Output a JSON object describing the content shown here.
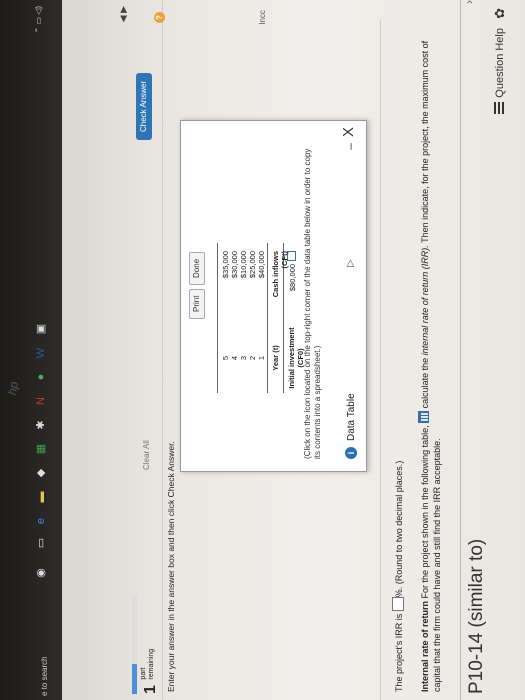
{
  "header": {
    "title": "P10-14 (similar to)",
    "question_help": "Question Help"
  },
  "problem": {
    "lead": "Internal rate of return",
    "text_a": " For the project shown in the following table,",
    "text_b": " calculate the ",
    "irr_term": "internal rate of return (IRR).",
    "text_c": " Then indicate, for the project, the maximum cost of capital that the firm could have and still find the IRR acceptable.",
    "irr_prefix": "The project's IRR is ",
    "irr_value": "",
    "irr_suffix": "%. (Round to two decimal places.)"
  },
  "popup": {
    "title": "Data Table",
    "minimize": "–",
    "close": "X",
    "note": "(Click on the icon located on the top-right corner of the data table below in order to copy its contents into a spreadsheet.)",
    "initial_label": "Initial investment (CF0)",
    "initial_value": "$80,000",
    "year_header": "Year (t)",
    "cash_header": "Cash inflows (CFt)",
    "rows": [
      {
        "year": "1",
        "cash": "$40,000"
      },
      {
        "year": "2",
        "cash": "$25,000"
      },
      {
        "year": "3",
        "cash": "$10,000"
      },
      {
        "year": "4",
        "cash": "$30,000"
      },
      {
        "year": "5",
        "cash": "$35,000"
      }
    ],
    "print": "Print",
    "done": "Done"
  },
  "footer": {
    "enter_text": "Enter your answer in the answer box and then click Check Answer.",
    "parts_num": "1",
    "parts_text_1": "part",
    "parts_text_2": "remaining",
    "progress": 0.3,
    "clear_all": "Clear All",
    "check_answer": "Check Answer",
    "side_text": "Incc"
  },
  "taskbar": {
    "search": "e to search",
    "brand": "hp"
  }
}
